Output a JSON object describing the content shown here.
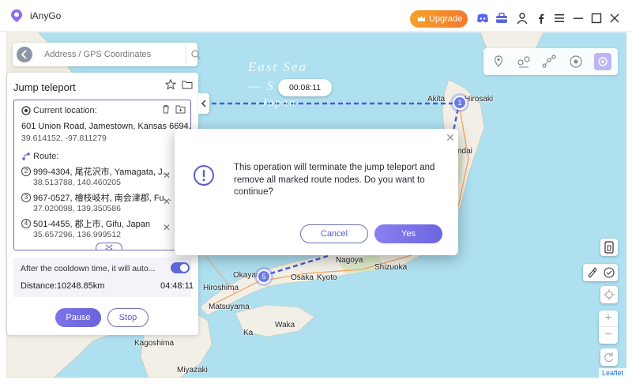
{
  "app": {
    "title": "iAnyGo",
    "upgrade_label": "Upgrade"
  },
  "titlebar_icons": [
    "discord-icon",
    "toolbox-icon",
    "user-icon",
    "facebook-icon",
    "menu-icon",
    "minimize-icon",
    "maximize-icon",
    "close-icon"
  ],
  "search": {
    "placeholder": "Address / GPS Coordinates"
  },
  "panel": {
    "title": "Jump teleport",
    "current_location_label": "Current location:",
    "current_address": "601 Union Road, Jamestown, Kansas 6694...",
    "current_coords": "39.614152, -97.811279",
    "route_label": "Route:",
    "route": [
      {
        "num": "2",
        "address": "999-4304, 尾花沢市, Yamagata, J...",
        "coords": "38.513788, 140.460205"
      },
      {
        "num": "3",
        "address": "967-0527, 檜枝岐村, 南会津郡, Fu...",
        "coords": "37.020098, 139.350586"
      },
      {
        "num": "4",
        "address": "501-4455, 郡上市, Gifu, Japan",
        "coords": "35.657296, 136.999512"
      }
    ],
    "cooldown_text": "After the cooldown time, it will auto...",
    "distance": "Distance:10248.85km",
    "timer": "04:48:11",
    "pause_label": "Pause",
    "stop_label": "Stop"
  },
  "countdown": "00:08:11",
  "map": {
    "sea_line1": "East Sea",
    "sea_line2": "— S",
    "sea_line3": "Japan",
    "cities": {
      "akita": "Akita",
      "hirosaki": "Hirosaki",
      "sendai": "ndai",
      "nagoya": "Nagoya",
      "osaka": "Osaka",
      "kyoto": "Kyoto",
      "shizuoka": "Shizuoka",
      "okayama": "Okayama",
      "hiroshima": "Hiroshima",
      "matsuyama": "Matsuyama",
      "kagoshima": "Kagoshima",
      "miyazaki": "Miyazaki",
      "ka": "Ka",
      "waka": "Waka"
    },
    "markers": {
      "m1": "1",
      "m5": "5"
    },
    "attribution": "Leaflet"
  },
  "modal": {
    "message": "This operation will terminate the jump teleport and remove all marked route nodes. Do you want to continue?",
    "cancel_label": "Cancel",
    "yes_label": "Yes"
  },
  "colors": {
    "accent": "#6a64d8",
    "upgrade": "#f5902a",
    "route_line": "#4a5ad8",
    "sea": "#aee0f0",
    "land": "#f2efe6"
  }
}
